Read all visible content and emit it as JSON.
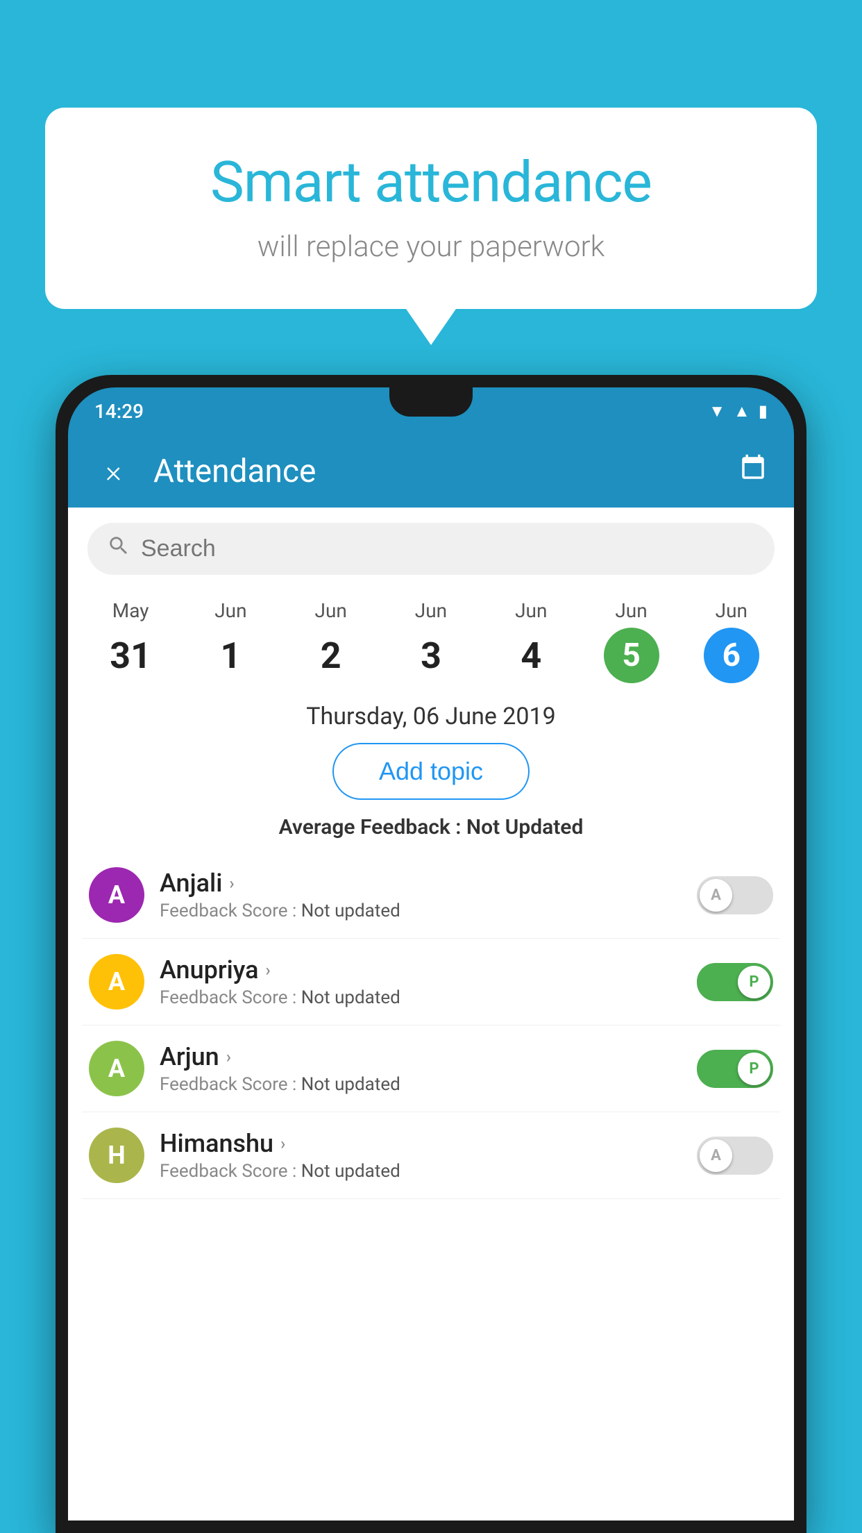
{
  "background_color": "#29b6d8",
  "speech_bubble": {
    "title": "Smart attendance",
    "subtitle": "will replace your paperwork"
  },
  "status_bar": {
    "time": "14:29",
    "wifi": "▲",
    "signal": "▲",
    "battery": "▮"
  },
  "app_bar": {
    "title": "Attendance",
    "close_icon": "×",
    "calendar_icon": "📅"
  },
  "search": {
    "placeholder": "Search"
  },
  "calendar": {
    "dates": [
      {
        "month": "May",
        "day": "31",
        "type": "normal"
      },
      {
        "month": "Jun",
        "day": "1",
        "type": "normal"
      },
      {
        "month": "Jun",
        "day": "2",
        "type": "normal"
      },
      {
        "month": "Jun",
        "day": "3",
        "type": "normal"
      },
      {
        "month": "Jun",
        "day": "4",
        "type": "normal"
      },
      {
        "month": "Jun",
        "day": "5",
        "type": "today"
      },
      {
        "month": "Jun",
        "day": "6",
        "type": "selected"
      }
    ],
    "selected_date": "Thursday, 06 June 2019"
  },
  "add_topic_label": "Add topic",
  "avg_feedback": {
    "label": "Average Feedback : ",
    "value": "Not Updated"
  },
  "students": [
    {
      "name": "Anjali",
      "initial": "A",
      "avatar_color": "purple",
      "feedback": "Feedback Score : Not updated",
      "toggle_state": "off",
      "toggle_label": "A"
    },
    {
      "name": "Anupriya",
      "initial": "A",
      "avatar_color": "yellow",
      "feedback": "Feedback Score : Not updated",
      "toggle_state": "on",
      "toggle_label": "P"
    },
    {
      "name": "Arjun",
      "initial": "A",
      "avatar_color": "lightgreen",
      "feedback": "Feedback Score : Not updated",
      "toggle_state": "on",
      "toggle_label": "P"
    },
    {
      "name": "Himanshu",
      "initial": "H",
      "avatar_color": "khaki",
      "feedback": "Feedback Score : Not updated",
      "toggle_state": "off",
      "toggle_label": "A"
    }
  ]
}
